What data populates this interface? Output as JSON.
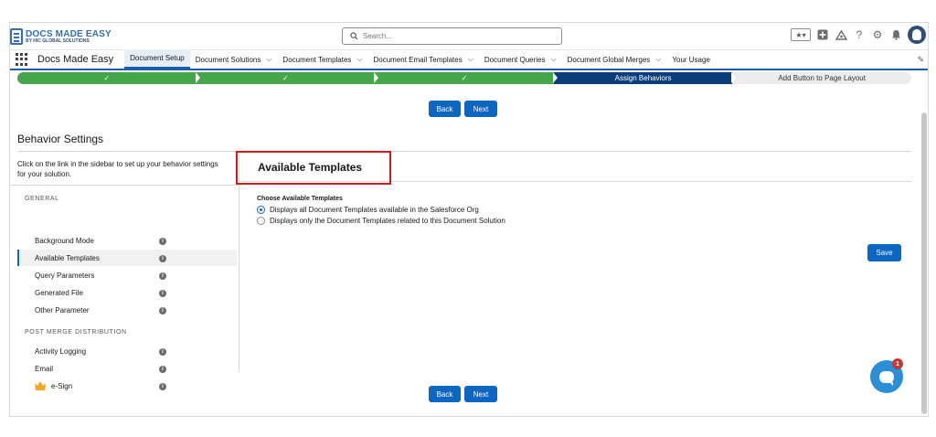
{
  "brand": {
    "logo_main": "DOCS MADE EASY",
    "logo_sub": "BY HIC GLOBAL SOLUTIONS",
    "app_name": "Docs Made Easy"
  },
  "search": {
    "placeholder": "Search..."
  },
  "header_icons": [
    "favorites-star-icon",
    "add-icon",
    "trailhead-icon",
    "help-icon",
    "settings-gear-icon",
    "notification-bell-icon",
    "user-avatar"
  ],
  "nav": {
    "tabs": [
      {
        "label": "Document Setup",
        "active": true,
        "dropdown": false
      },
      {
        "label": "Document Solutions",
        "dropdown": true
      },
      {
        "label": "Document Templates",
        "dropdown": true
      },
      {
        "label": "Document Email Templates",
        "dropdown": true
      },
      {
        "label": "Document Queries",
        "dropdown": true
      },
      {
        "label": "Document Global Merges",
        "dropdown": true
      },
      {
        "label": "Your Usage",
        "dropdown": false
      }
    ]
  },
  "path": {
    "steps": [
      {
        "label": "✓",
        "state": "done"
      },
      {
        "label": "✓",
        "state": "done"
      },
      {
        "label": "✓",
        "state": "done"
      },
      {
        "label": "Assign Behaviors",
        "state": "current"
      },
      {
        "label": "Add Button to Page Layout",
        "state": "todo"
      }
    ]
  },
  "buttons": {
    "back": "Back",
    "next": "Next",
    "save": "Save"
  },
  "behavior": {
    "title": "Behavior Settings",
    "description": "Click on the link in the sidebar to set up your behavior settings for your solution.",
    "section_general": "GENERAL",
    "section_post": "POST MERGE DISTRIBUTION",
    "general_items": [
      "Background Mode",
      "Available Templates",
      "Query Parameters",
      "Generated File",
      "Other Parameter"
    ],
    "post_items": [
      "Activity Logging",
      "Email",
      "e-Sign"
    ]
  },
  "available": {
    "title": "Available Templates",
    "choose_label": "Choose Available Templates",
    "option_all": "Displays all Document Templates available in the Salesforce Org",
    "option_related": "Displays only the Document Templates related to this Document Solution",
    "selected": "all"
  },
  "chat": {
    "badge_count": "1"
  },
  "colors": {
    "brand_blue": "#0b66c4",
    "done_green": "#45a64a",
    "current_navy": "#0b3d7a",
    "highlight_red": "#d11a1a"
  }
}
